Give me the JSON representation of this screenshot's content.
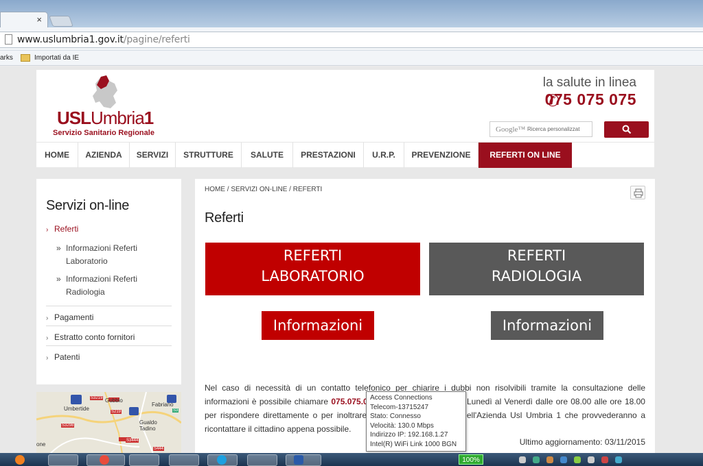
{
  "browser": {
    "tab_close": "×",
    "url_host": "www.uslumbria1.gov.it",
    "url_path": "/pagine/referti",
    "bookmarks": {
      "item1": "arks",
      "folder": "Importati da IE"
    }
  },
  "header": {
    "logo_bold": "USL",
    "logo_light": "Umbria",
    "logo_num": "1",
    "logo_sub": "Servizio Sanitario Regionale",
    "tagline": "la salute in linea",
    "phone": "075 075 075",
    "search_google": "Google™",
    "search_placeholder": "Ricerca personalizzat"
  },
  "nav": {
    "items": [
      "HOME",
      "AZIENDA",
      "SERVIZI",
      "STRUTTURE",
      "SALUTE",
      "PRESTAZIONI",
      "U.R.P.",
      "PREVENZIONE",
      "REFERTI ON LINE"
    ]
  },
  "sidebar": {
    "title": "Servizi on-line",
    "active_item": "Referti",
    "sub_items": [
      "Informazioni Referti Laboratorio",
      "Informazioni Referti Radiologia"
    ],
    "items": [
      "Pagamenti",
      "Estratto conto fornitori",
      "Patenti"
    ],
    "map_labels": [
      "Gubbio",
      "Umbertide",
      "Fabriano",
      "Gualdo Tadino",
      "S3219",
      "S219",
      "S3298",
      "S3",
      "S3444",
      "S444",
      "one"
    ]
  },
  "main": {
    "breadcrumb": "HOME / SERVIZI ON-LINE / REFERTI",
    "title": "Referti",
    "btn_lab_line1": "REFERTI",
    "btn_lab_line2": "LABORATORIO",
    "btn_rad_line1": "REFERTI",
    "btn_rad_line2": "RADIOLOGIA",
    "info_label": "Informazioni",
    "text_1": "Nel caso di necessità di un contatto telefonico per chiarire i dubbi non risolvibili tramite la consultazione delle informazioni è possibile chiamare",
    "text_phone": "075.075.0",
    "text_2": "Lunedì al Venerdì dalle ore 08.00 alle ore 18.00",
    "text_3": "per rispondere direttamente o per inoltrare",
    "text_4": "ell'Azienda Usl Umbria 1 che provvederanno a",
    "text_5": "ricontattare il cittadino appena possibile.",
    "updated": "Ultimo aggiornamento: 03/11/2015"
  },
  "tooltip": {
    "lines": [
      "Access Connections",
      "Telecom-13715247",
      "Stato: Connesso",
      "Velocità: 130.0 Mbps",
      "Indirizzo IP: 192.168.1.27",
      "Intel(R) WiFi Link 1000 BGN"
    ]
  },
  "taskbar": {
    "battery_label": "100%"
  },
  "colors": {
    "brand": "#9a0f1e",
    "red_button": "#c00000",
    "gray_button": "#595959"
  }
}
